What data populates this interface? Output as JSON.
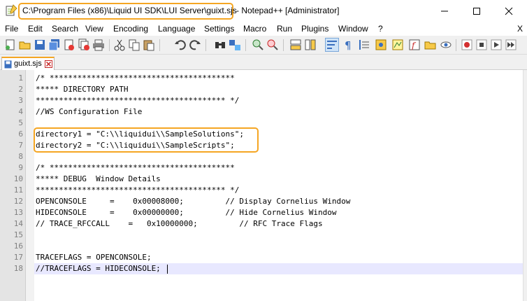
{
  "window": {
    "title_path": "C:\\Program Files (x86)\\Liquid UI SDK\\LUI Server\\guixt.sjs",
    "title_rest": "- Notepad++ [Administrator]"
  },
  "menu": {
    "items": [
      "File",
      "Edit",
      "Search",
      "View",
      "Encoding",
      "Language",
      "Settings",
      "Macro",
      "Run",
      "Plugins",
      "Window",
      "?"
    ],
    "close_x": "X"
  },
  "tabs": [
    {
      "label": "guixt.sjs"
    }
  ],
  "editor": {
    "line_numbers": [
      "1",
      "2",
      "3",
      "4",
      "5",
      "6",
      "7",
      "8",
      "9",
      "10",
      "11",
      "12",
      "13",
      "14",
      "15",
      "16",
      "17",
      "18"
    ],
    "lines": [
      "/* ****************************************",
      "***** DIRECTORY PATH",
      "***************************************** */",
      "//WS Configuration File",
      "",
      "directory1 = \"C:\\\\liquidui\\\\SampleSolutions\";",
      "directory2 = \"C:\\\\liquidui\\\\SampleScripts\";",
      "",
      "/* ****************************************",
      "***** DEBUG  Window Details",
      "***************************************** */",
      "OPENCONSOLE     =    0x00008000;         // Display Cornelius Window",
      "HIDECONSOLE     =    0x00000000;         // Hide Cornelius Window",
      "// TRACE_RFCCALL    =   0x10000000;         // RFC Trace Flags",
      "",
      "",
      "TRACEFLAGS = OPENCONSOLE;",
      "//TRACEFLAGS = HIDECONSOLE;"
    ],
    "current_line": 18
  },
  "colors": {
    "highlight": "#f5a623",
    "current_line": "#e8e8ff",
    "gutter": "#e4e4e4"
  }
}
